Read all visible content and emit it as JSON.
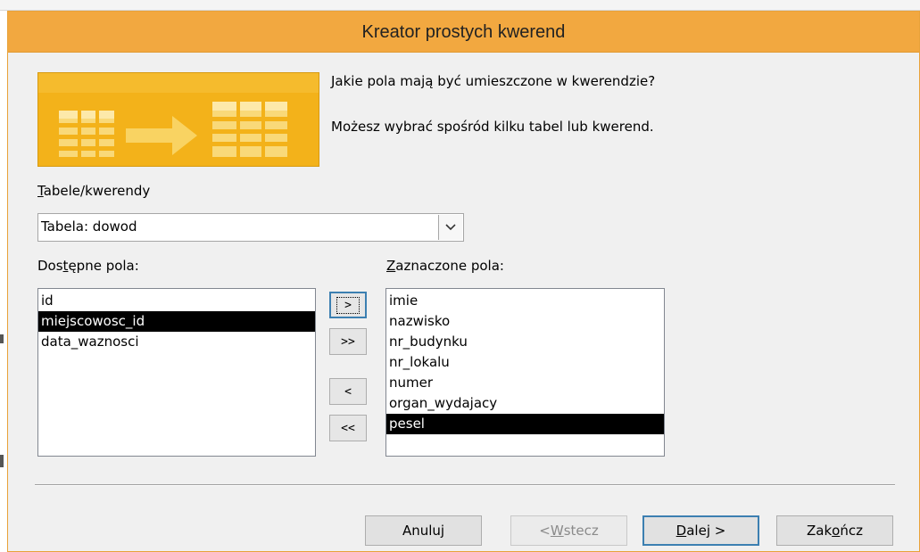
{
  "window": {
    "title": "Kreator prostych kwerend"
  },
  "intro": {
    "question": "Jakie pola mają być umieszczone w kwerendzie?",
    "hint": "Możesz wybrać spośród kilku tabel lub kwerend."
  },
  "tables": {
    "label_u": "T",
    "label_rest": "abele/kwerendy",
    "selected": "Tabela: dowod"
  },
  "available": {
    "label_pre": "Dos",
    "label_u": "t",
    "label_post": "ępne pola:",
    "items": [
      "id",
      "miejscowosc_id",
      "data_waznosci"
    ],
    "selected_index": 1
  },
  "selected_fields": {
    "label_u": "Z",
    "label_rest": "aznaczone pola:",
    "items": [
      "imie",
      "nazwisko",
      "nr_budynku",
      "nr_lokalu",
      "numer",
      "organ_wydajacy",
      "pesel"
    ],
    "selected_index": 6
  },
  "move_buttons": {
    "add_one": ">",
    "add_all": ">>",
    "remove_one": "<",
    "remove_all": "<<"
  },
  "buttons": {
    "cancel": "Anuluj",
    "back_pre": "< ",
    "back_u": "W",
    "back_post": "stecz",
    "next_u": "D",
    "next_post": "alej >",
    "finish_pre": "Zak",
    "finish_u": "o",
    "finish_post": "ńcz"
  },
  "colors": {
    "title_bar": "#f2a840",
    "illustration": "#f3b21a",
    "selection": "#000000"
  },
  "icons": {
    "combo": "chevron-down-icon",
    "illustration": "table-transform-icon"
  }
}
